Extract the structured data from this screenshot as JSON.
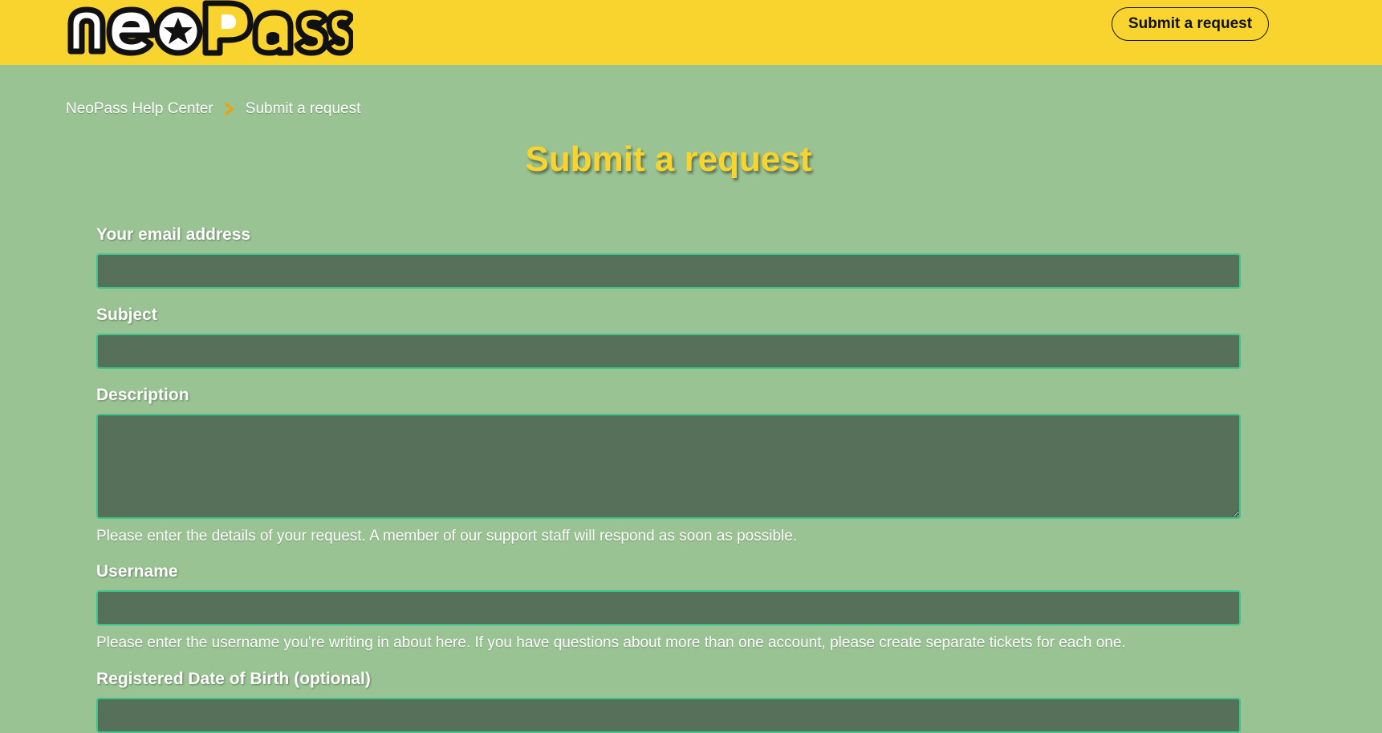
{
  "header": {
    "logo_text": "neoPass",
    "submit_button_label": "Submit a request"
  },
  "breadcrumb": {
    "home": "NeoPass Help Center",
    "current": "Submit a request",
    "separator_icon": "chevron-right-icon"
  },
  "page": {
    "title": "Submit a request"
  },
  "form": {
    "email": {
      "label": "Your email address",
      "value": ""
    },
    "subject": {
      "label": "Subject",
      "value": ""
    },
    "description": {
      "label": "Description",
      "value": "",
      "hint": "Please enter the details of your request. A member of our support staff will respond as soon as possible."
    },
    "username": {
      "label": "Username",
      "value": "",
      "hint": "Please enter the username you're writing in about here. If you have questions about more than one account, please create separate tickets for each one."
    },
    "dob": {
      "label": "Registered Date of Birth (optional)",
      "value": ""
    }
  },
  "colors": {
    "header_bg": "#f9d42e",
    "page_bg": "#9ac393",
    "input_bg": "#56705a",
    "input_border": "#3cc58c",
    "title": "#f9d42e",
    "chevron": "#e8a317"
  }
}
